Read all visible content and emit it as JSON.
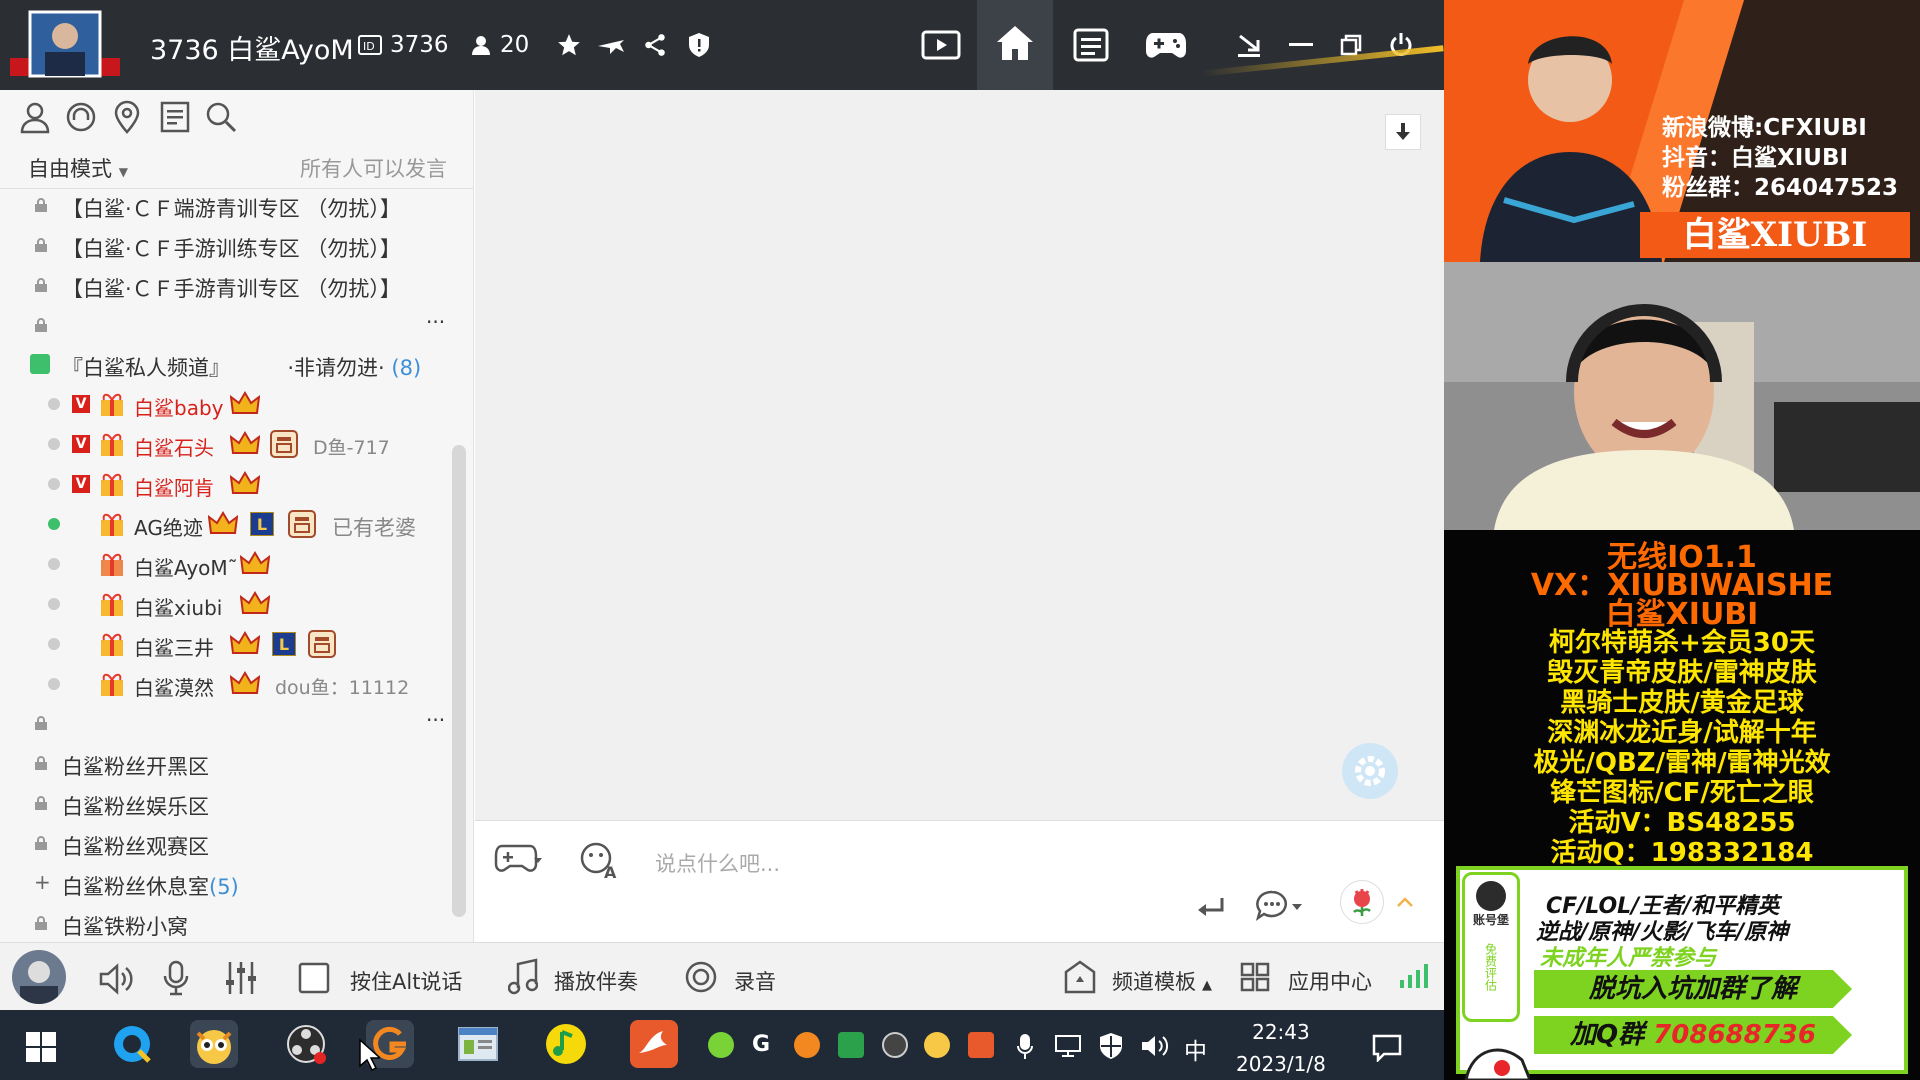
{
  "window": {
    "title": "3736 白鲨AyoM",
    "room_id": "3736",
    "online_count": "20"
  },
  "sidebar": {
    "mode_label": "自由模式",
    "speak_permission": "所有人可以发言",
    "channels_top": [
      {
        "label": "【白鲨·ＣＦ端游青训专区 （勿扰）】"
      },
      {
        "label": "【白鲨·ＣＦ手游训练专区 （勿扰）】"
      },
      {
        "label": "【白鲨·ＣＦ手游青训专区 （勿扰）】"
      }
    ],
    "private_channel": {
      "label": "『白鲨私人频道』",
      "tag": "·非请勿进·",
      "count": "(8)"
    },
    "members": [
      {
        "name": "白鲨baby",
        "note": "",
        "online": false
      },
      {
        "name": "白鲨石头",
        "note": "D鱼-717",
        "online": false
      },
      {
        "name": "白鲨阿肯",
        "note": "",
        "online": false
      },
      {
        "name": "AG绝迹",
        "note": "已有老婆",
        "online": true
      },
      {
        "name": "白鲨AyoM˜",
        "note": "",
        "online": false
      },
      {
        "name": "白鲨xiubi",
        "note": "",
        "online": false
      },
      {
        "name": "白鲨三井",
        "note": "",
        "online": false
      },
      {
        "name": "白鲨漠然",
        "note": "dou鱼：11112",
        "online": false
      }
    ],
    "channels_bottom": [
      {
        "label": "白鲨粉丝开黑区",
        "count": ""
      },
      {
        "label": "白鲨粉丝娱乐区",
        "count": ""
      },
      {
        "label": "白鲨粉丝观赛区",
        "count": ""
      },
      {
        "label": "白鲨粉丝休息室",
        "count": "(5)"
      },
      {
        "label": "白鲨铁粉小窝",
        "count": ""
      }
    ],
    "more": "···"
  },
  "chat": {
    "input_placeholder": "说点什么吧..."
  },
  "bottombar": {
    "push_to_talk": "按住Alt说话",
    "play_accompaniment": "播放伴奏",
    "record": "录音",
    "channel_template": "频道模板",
    "app_center": "应用中心"
  },
  "taskbar": {
    "ime": "中",
    "time": "22:43",
    "date": "2023/1/8"
  },
  "stream": {
    "weibo": "新浪微博:CFXIUBI",
    "douyin": "抖音：白鲨XIUBI",
    "fans_group": "粉丝群：264047523",
    "banner": "白鲨XIUBI",
    "promo_lines": [
      "无线IO1.1",
      "VX：XIUBIWAISHE",
      "白鲨XIUBI",
      "柯尔特萌杀+会员30天",
      "毁灭青帝皮肤/雷神皮肤",
      "黑骑士皮肤/黄金足球",
      "深渊冰龙近身/试解十年",
      "极光/QBZ/雷神/雷神光效",
      "锋芒图标/CF/死亡之眼",
      "活动V：BS48255",
      "活动Q：198332184"
    ],
    "ad_badge": "账号堡",
    "ad_badge2": "免费评估",
    "ad_line1": "CF/LOL/王者/和平精英",
    "ad_line2": "逆战/原神/火影/飞车/原神",
    "ad_line3": "未成年人严禁参与",
    "ad_line4": "脱坑入坑加群了解",
    "ad_line5_prefix": "加Q群",
    "ad_line5_number": "708688736"
  },
  "colors": {
    "topbar": "#2b2e33",
    "accent_red": "#d8211b",
    "stream_orange": "#f25a16",
    "promo_orange": "#ff6a00",
    "promo_yellow": "#ffe600",
    "ad_green": "#7ed321"
  }
}
